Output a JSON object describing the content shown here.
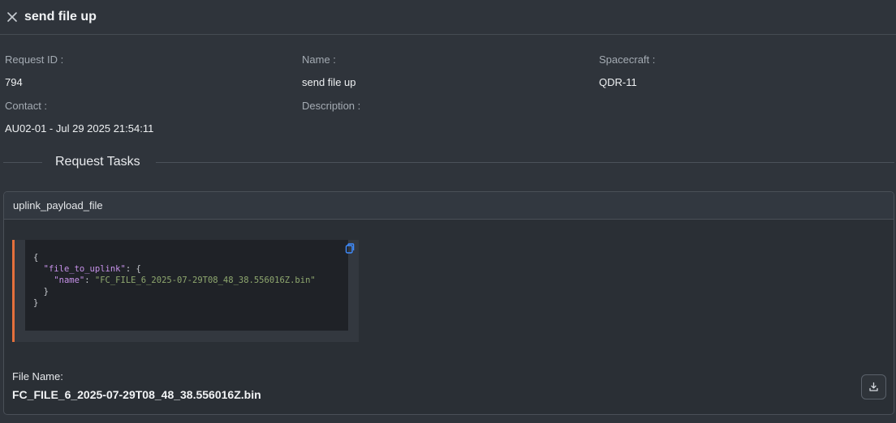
{
  "header": {
    "title": "send file up",
    "close_icon": "close-icon"
  },
  "meta": {
    "request_id_label": "Request ID",
    "request_id_value": "794",
    "name_label": "Name",
    "name_value": "send file up",
    "spacecraft_label": "Spacecraft",
    "spacecraft_value": "QDR-11",
    "contact_label": "Contact",
    "contact_value": "AU02-01 - Jul 29 2025 21:54:11",
    "description_label": "Description",
    "description_value": ""
  },
  "section": {
    "title": "Request Tasks"
  },
  "task": {
    "name": "uplink_payload_file",
    "code": {
      "key_outer": "\"file_to_uplink\"",
      "key_inner": "\"name\"",
      "value": "\"FC_FILE_6_2025-07-29T08_48_38.556016Z.bin\""
    },
    "file_name_label": "File Name:",
    "file_name_value": "FC_FILE_6_2025-07-29T08_48_38.556016Z.bin",
    "icons": {
      "copy": "copy-icon",
      "download": "download-icon"
    }
  },
  "colors": {
    "accent_bar": "#e4703c",
    "background": "#2f343b",
    "code_bg": "#1f2227"
  }
}
